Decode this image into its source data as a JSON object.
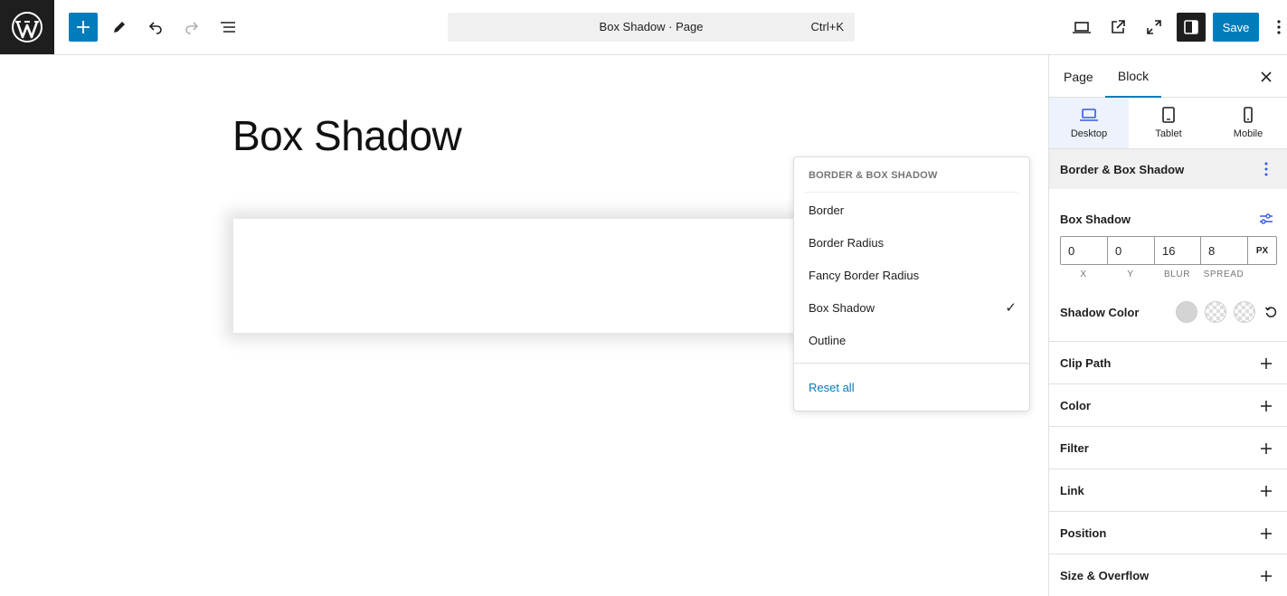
{
  "topbar": {
    "document_title": "Box Shadow · Page",
    "shortcut": "Ctrl+K",
    "save_label": "Save",
    "colors": {
      "accent": "#007cba",
      "dark": "#1e1e1e"
    }
  },
  "canvas": {
    "page_title": "Box Shadow"
  },
  "dropdown": {
    "heading": "BORDER & BOX SHADOW",
    "items": [
      {
        "label": "Border",
        "checked": false
      },
      {
        "label": "Border Radius",
        "checked": false
      },
      {
        "label": "Fancy Border Radius",
        "checked": false
      },
      {
        "label": "Box Shadow",
        "checked": true
      },
      {
        "label": "Outline",
        "checked": false
      }
    ],
    "check_mark": "✓",
    "reset_label": "Reset all"
  },
  "sidebar": {
    "tabs": [
      {
        "label": "Page",
        "active": false
      },
      {
        "label": "Block",
        "active": true
      }
    ],
    "devices": [
      {
        "label": "Desktop",
        "icon": "laptop-icon",
        "active": true
      },
      {
        "label": "Tablet",
        "icon": "tablet-icon",
        "active": false
      },
      {
        "label": "Mobile",
        "icon": "mobile-icon",
        "active": false
      }
    ],
    "section_title": "Border & Box Shadow",
    "box_shadow": {
      "label": "Box Shadow",
      "x": "0",
      "y": "0",
      "blur": "16",
      "spread": "8",
      "unit": "PX",
      "captions": [
        "X",
        "Y",
        "BLUR",
        "SPREAD"
      ]
    },
    "shadow_color_label": "Shadow Color",
    "panels": [
      "Clip Path",
      "Color",
      "Filter",
      "Link",
      "Position",
      "Size & Overflow"
    ]
  }
}
